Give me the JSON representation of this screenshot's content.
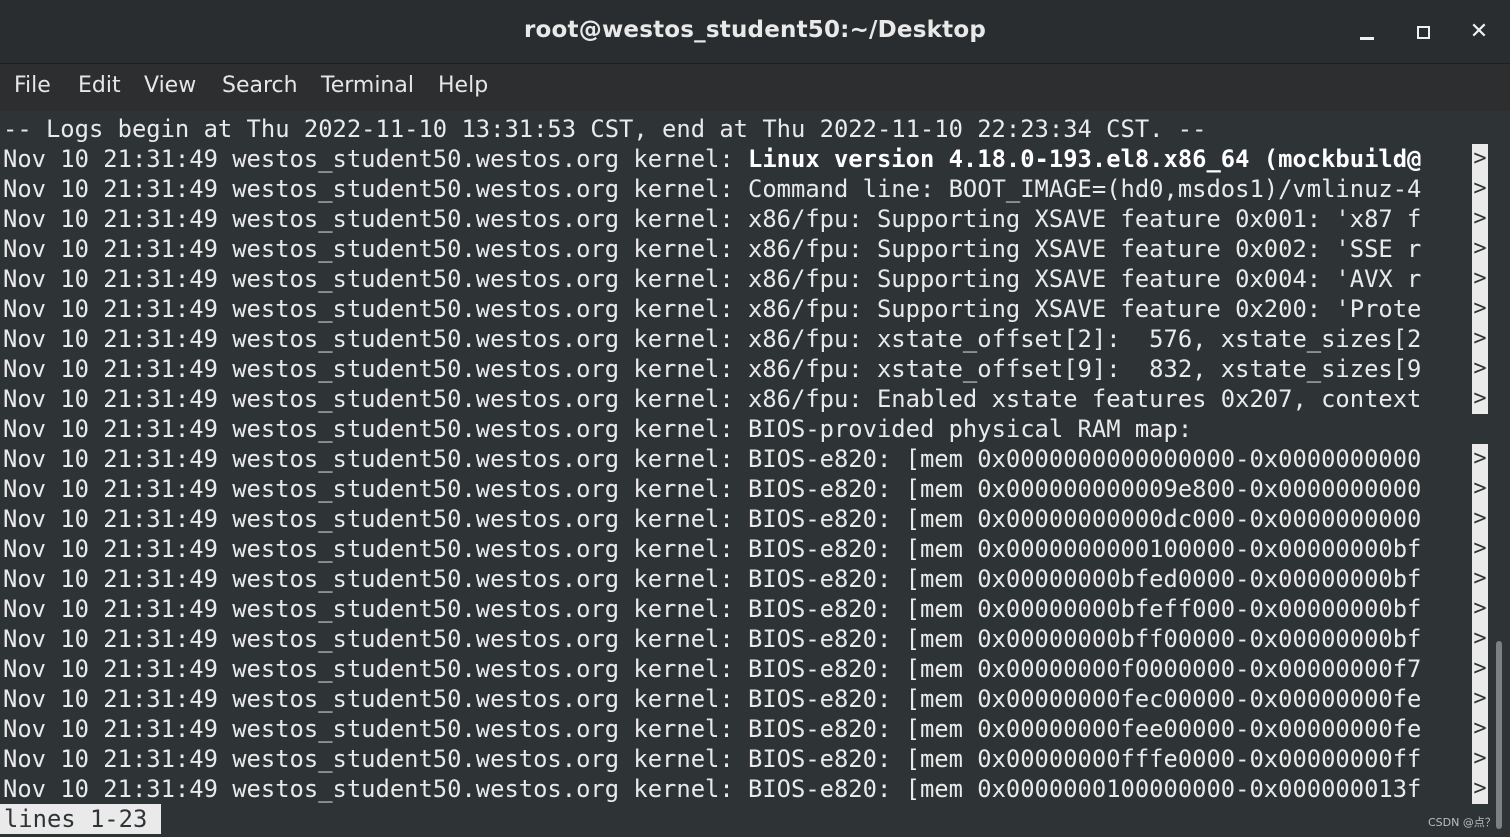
{
  "window": {
    "title": "root@westos_student50:~/Desktop",
    "controls": {
      "minimize_icon": "minimize-icon",
      "maximize_icon": "maximize-icon",
      "close_icon": "close-icon",
      "close_glyph": "✕"
    }
  },
  "menu": {
    "items": [
      "File",
      "Edit",
      "View",
      "Search",
      "Terminal",
      "Help"
    ]
  },
  "terminal": {
    "header_line": "-- Logs begin at Thu 2022-11-10 13:31:53 CST, end at Thu 2022-11-10 22:23:34 CST. --",
    "prefix": "Nov 10 21:31:49 westos_student50.westos.org kernel: ",
    "messages": [
      "Linux version 4.18.0-193.el8.x86_64 (mockbuild@",
      "Command line: BOOT_IMAGE=(hd0,msdos1)/vmlinuz-4",
      "x86/fpu: Supporting XSAVE feature 0x001: 'x87 f",
      "x86/fpu: Supporting XSAVE feature 0x002: 'SSE r",
      "x86/fpu: Supporting XSAVE feature 0x004: 'AVX r",
      "x86/fpu: Supporting XSAVE feature 0x200: 'Prote",
      "x86/fpu: xstate_offset[2]:  576, xstate_sizes[2",
      "x86/fpu: xstate_offset[9]:  832, xstate_sizes[9",
      "x86/fpu: Enabled xstate features 0x207, context",
      "BIOS-provided physical RAM map:",
      "BIOS-e820: [mem 0x0000000000000000-0x0000000000",
      "BIOS-e820: [mem 0x000000000009e800-0x0000000000",
      "BIOS-e820: [mem 0x00000000000dc000-0x0000000000",
      "BIOS-e820: [mem 0x0000000000100000-0x00000000bf",
      "BIOS-e820: [mem 0x00000000bfed0000-0x00000000bf",
      "BIOS-e820: [mem 0x00000000bfeff000-0x00000000bf",
      "BIOS-e820: [mem 0x00000000bff00000-0x00000000bf",
      "BIOS-e820: [mem 0x00000000f0000000-0x00000000f7",
      "BIOS-e820: [mem 0x00000000fec00000-0x00000000fe",
      "BIOS-e820: [mem 0x00000000fee00000-0x00000000fe",
      "BIOS-e820: [mem 0x00000000fffe0000-0x00000000ff",
      "BIOS-e820: [mem 0x0000000100000000-0x000000013f"
    ],
    "truncated": [
      true,
      true,
      true,
      true,
      true,
      true,
      true,
      true,
      true,
      false,
      true,
      true,
      true,
      true,
      true,
      true,
      true,
      true,
      true,
      true,
      true,
      true
    ],
    "truncation_marker": ">",
    "status_line": "lines 1-23"
  },
  "watermark": "CSDN @点？"
}
